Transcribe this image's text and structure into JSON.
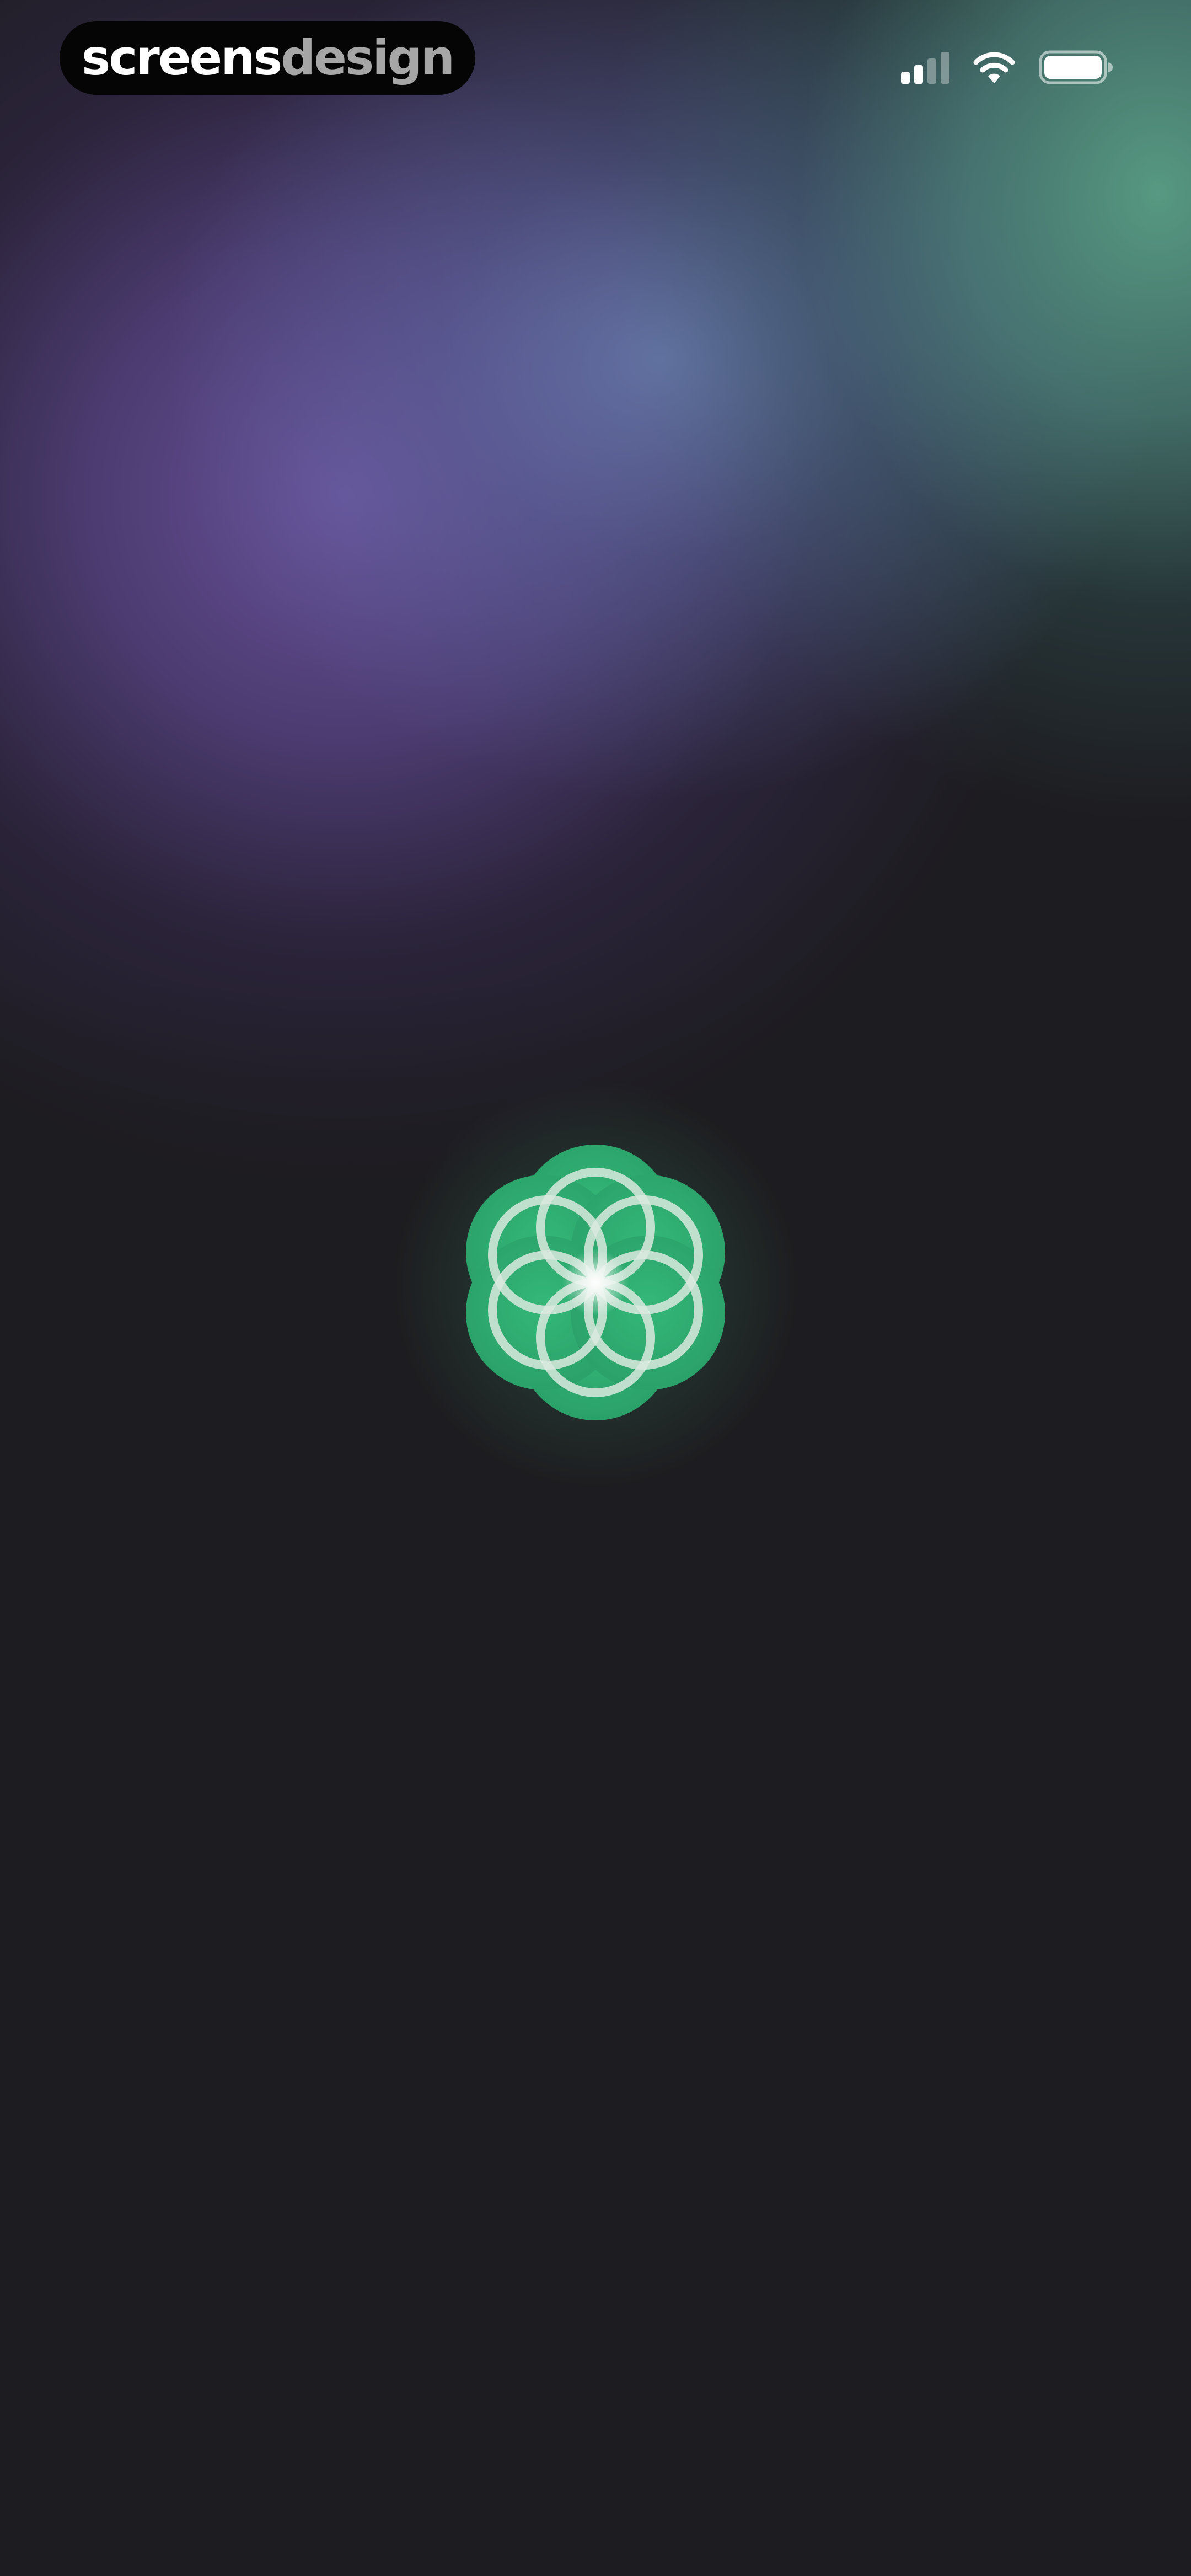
{
  "watermark": {
    "part1": "screens",
    "part2": "design"
  },
  "status_bar": {
    "signal_icon": "cellular-signal-icon",
    "signal_bars_active": 2,
    "signal_bars_total": 4,
    "wifi_icon": "wifi-icon",
    "battery_icon": "battery-icon",
    "battery_level": 1.0
  },
  "splash": {
    "logo_icon": "flower-of-life-logo-icon"
  },
  "colors": {
    "background": "#1d1c20",
    "logo_green": "#2fae73",
    "gradient_purple": "#6c54a0",
    "gradient_teal": "#5aa087"
  }
}
